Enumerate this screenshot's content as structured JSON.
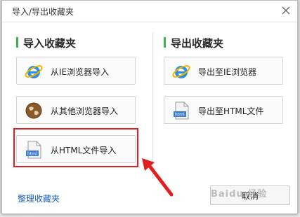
{
  "dialog": {
    "title": "导入/导出收藏夹",
    "close_icon": "close-icon"
  },
  "import_section": {
    "heading": "导入收藏夹",
    "options": [
      {
        "label": "从IE浏览器导入",
        "icon": "ie-browser-icon"
      },
      {
        "label": "从其他浏览器导入",
        "icon": "globe-icon"
      },
      {
        "label": "从HTML文件导入",
        "icon": "html-file-icon"
      }
    ]
  },
  "export_section": {
    "heading": "导出收藏夹",
    "options": [
      {
        "label": "导出至IE浏览器",
        "icon": "ie-browser-icon"
      },
      {
        "label": "导出至HTML文件",
        "icon": "html-file-icon"
      }
    ]
  },
  "footer": {
    "organize_link": "整理收藏夹",
    "cancel_label": "取消"
  },
  "annotation": {
    "highlight_color": "#e02020",
    "accent_color": "#3fb34f",
    "watermark": "Baidu 经验"
  }
}
